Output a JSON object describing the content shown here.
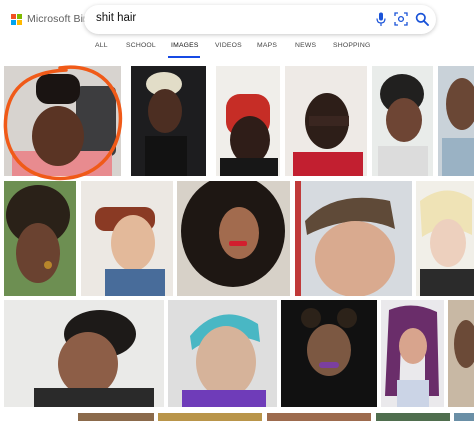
{
  "header": {
    "logo_text": "Microsoft Bing",
    "logo_colors": [
      "#f25022",
      "#7fba00",
      "#00a4ef",
      "#ffb900"
    ]
  },
  "search": {
    "query": "shit hair"
  },
  "tabs": [
    {
      "label": "ALL",
      "active": false
    },
    {
      "label": "SCHOOL",
      "active": false
    },
    {
      "label": "IMAGES",
      "active": true
    },
    {
      "label": "VIDEOS",
      "active": false
    },
    {
      "label": "MAPS",
      "active": false
    },
    {
      "label": "NEWS",
      "active": false
    },
    {
      "label": "SHOPPING",
      "active": false
    }
  ],
  "colors": {
    "accent": "#174ae4",
    "icon_blue": "#1a53d8",
    "annotation": "#f05a18"
  },
  "icons": [
    "microphone-icon",
    "visual-search-icon",
    "search-icon"
  ]
}
